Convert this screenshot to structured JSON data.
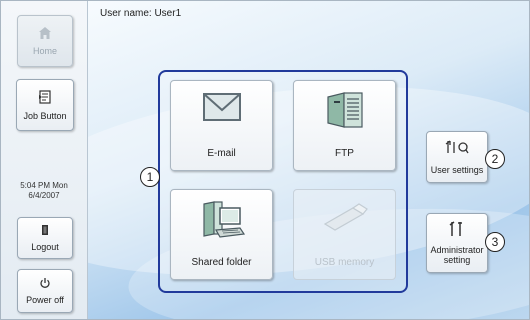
{
  "header": {
    "user_label": "User name: User1"
  },
  "sidebar": {
    "home_label": "Home",
    "job_button_label": "Job Button",
    "clock_time": "5:04 PM  Mon",
    "clock_date": "6/4/2007",
    "logout_label": "Logout",
    "power_off_label": "Power off"
  },
  "main": {
    "tiles": [
      {
        "label": "E-mail",
        "icon": "envelope-icon",
        "enabled": true
      },
      {
        "label": "FTP",
        "icon": "ftp-server-icon",
        "enabled": true
      },
      {
        "label": "Shared folder",
        "icon": "shared-folder-computer-icon",
        "enabled": true
      },
      {
        "label": "USB memory",
        "icon": "usb-memory-icon",
        "enabled": false
      }
    ],
    "user_settings_label": "User settings",
    "admin_setting_line1": "Administrator",
    "admin_setting_line2": "setting"
  },
  "callouts": [
    "1",
    "2",
    "3"
  ],
  "colors": {
    "panel_border": "#213a9b",
    "disabled_text": "#b9c2ca"
  }
}
